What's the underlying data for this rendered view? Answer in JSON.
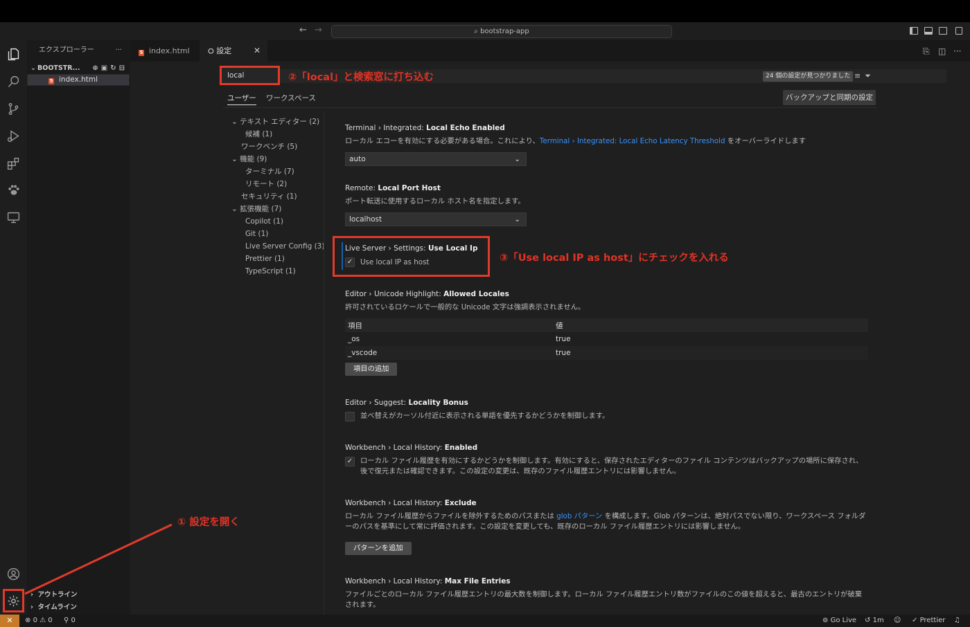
{
  "titlebar": {
    "search_text": "bootstrap-app"
  },
  "sidebar": {
    "title": "エクスプローラー",
    "folder": "BOOTSTR...",
    "file": "index.html",
    "sections": [
      "アウトライン",
      "タイムライン"
    ]
  },
  "tabs": [
    {
      "label": "index.html"
    },
    {
      "label": "設定"
    }
  ],
  "search": {
    "value": "local",
    "found": "24 個の設定が見つかりました"
  },
  "scope_tabs": [
    "ユーザー",
    "ワークスペース"
  ],
  "backup_button": "バックアップと同期の設定",
  "toc": [
    "テキスト エディター (2)",
    "候補 (1)",
    "ワークベンチ (5)",
    "機能 (9)",
    "ターミナル (7)",
    "リモート (2)",
    "セキュリティ (1)",
    "拡張機能 (7)",
    "Copilot (1)",
    "Git (1)",
    "Live Server Config (3)",
    "Prettier (1)",
    "TypeScript (1)"
  ],
  "settings": {
    "s1": {
      "category": "Terminal › Integrated: ",
      "name": "Local Echo Enabled",
      "desc_pre": "ローカル エコーを有効にする必要がある場合。これにより、",
      "desc_link": "Terminal › Integrated: Local Echo Latency Threshold",
      "desc_post": " をオーバーライドします",
      "value": "auto"
    },
    "s2": {
      "category": "Remote: ",
      "name": "Local Port Host",
      "desc": "ポート転送に使用するローカル ホスト名を指定します。",
      "value": "localhost"
    },
    "s3": {
      "category": "Live Server › Settings: ",
      "name": "Use Local Ip",
      "checkbox_label": "Use local IP as host",
      "checked": true
    },
    "s4": {
      "category": "Editor › Unicode Highlight: ",
      "name": "Allowed Locales",
      "desc": "許可されているロケールで一般的な Unicode 文字は強調表示されません。",
      "col_item": "項目",
      "col_value": "値",
      "rows": [
        {
          "item": "_os",
          "value": "true"
        },
        {
          "item": "_vscode",
          "value": "true"
        }
      ],
      "add_button": "項目の追加"
    },
    "s5": {
      "category": "Editor › Suggest: ",
      "name": "Locality Bonus",
      "desc": "並べ替えがカーソル付近に表示される単語を優先するかどうかを制御します。",
      "checked": false
    },
    "s6": {
      "category": "Workbench › Local History: ",
      "name": "Enabled",
      "desc": "ローカル ファイル履歴を有効にするかどうかを制御します。有効にすると、保存されたエディターのファイル コンテンツはバックアップの場所に保存され、後で復元または確認できます。この設定の変更は、既存のファイル履歴エントリには影響しません。",
      "checked": true
    },
    "s7": {
      "category": "Workbench › Local History: ",
      "name": "Exclude",
      "desc_pre": "ローカル ファイル履歴からファイルを除外するためのパスまたは ",
      "desc_link": "glob パターン",
      "desc_post": " を構成します。Glob パターンは、絶対パスでない限り、ワークスペース フォルダーのパスを基準にして常に評価されます。この設定を変更しても、既存のローカル ファイル履歴エントリには影響しません。",
      "add_button": "パターンを追加"
    },
    "s8": {
      "category": "Workbench › Local History: ",
      "name": "Max File Entries",
      "desc": "ファイルごとのローカル ファイル履歴エントリの最大数を制御します。ローカル ファイル履歴エントリ数がファイルのこの値を超えると、最古のエントリが破棄されます。"
    }
  },
  "annotations": {
    "step1": "① 設定を開く",
    "step2": "②「local」と検索窓に打ち込む",
    "step3": "③「Use local IP as host」にチェックを入れる"
  },
  "statusbar": {
    "errors": "0",
    "warnings": "0",
    "ports": "0",
    "golive": "Go Live",
    "time": "1m",
    "prettier": "Prettier"
  },
  "colors": {
    "annotation": "#e13b2b",
    "link": "#3794ff",
    "remote": "#c57b2a"
  }
}
